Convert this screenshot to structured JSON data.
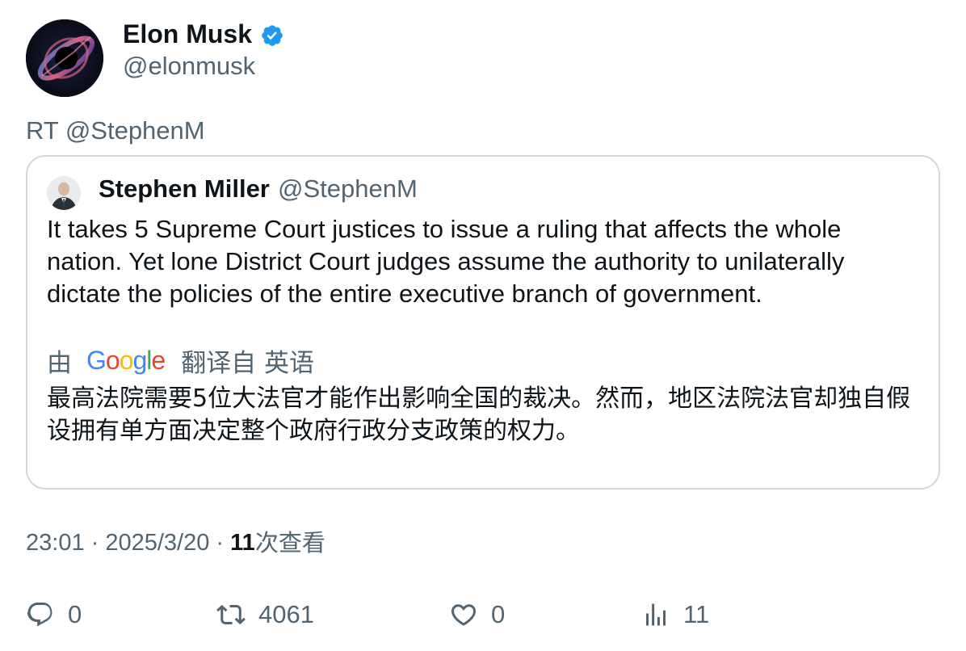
{
  "author": {
    "name": "Elon Musk",
    "handle": "@elonmusk",
    "verified_color": "#1d9bf0"
  },
  "retweet_label": "RT @StephenM",
  "quoted_tweet": {
    "name": "Stephen Miller",
    "handle": "@StephenM",
    "text": "It takes 5 Supreme Court justices to issue a ruling that affects the whole nation. Yet lone District Court judges assume the authority to unilaterally dictate the policies of the entire executive branch of government.",
    "translation": {
      "by_label": "由",
      "provider": "Google",
      "translated_from": "翻译自 英语",
      "text": "最高法院需要5位大法官才能作出影响全国的裁决。然而，地区法院法官却独自假设拥有单方面决定整个政府行政分支政策的权力。"
    }
  },
  "meta": {
    "time": "23:01",
    "separator": " · ",
    "date": "2025/3/20",
    "views_count": "11",
    "views_label": "次查看"
  },
  "actions": {
    "replies": "0",
    "retweets": "4061",
    "likes": "0",
    "views": "11"
  },
  "colors": {
    "text_primary": "#0f1419",
    "text_secondary": "#536471",
    "border": "#cfd9de",
    "google_blue": "#4285f4",
    "google_red": "#ea4335",
    "google_yellow": "#fbbc05",
    "google_green": "#34a853"
  },
  "icons": {
    "verified": "verified-badge-icon",
    "reply": "reply-icon",
    "retweet": "retweet-icon",
    "like": "heart-icon",
    "views": "views-bar-chart-icon"
  }
}
